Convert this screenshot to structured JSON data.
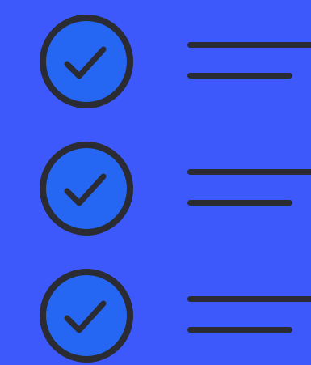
{
  "colors": {
    "background": "#3d59fb",
    "circle_fill": "#2566f3",
    "stroke": "#2a2b33"
  },
  "icon": "check-circle-icon",
  "items": [
    {
      "checked": true
    },
    {
      "checked": true
    },
    {
      "checked": true
    }
  ]
}
